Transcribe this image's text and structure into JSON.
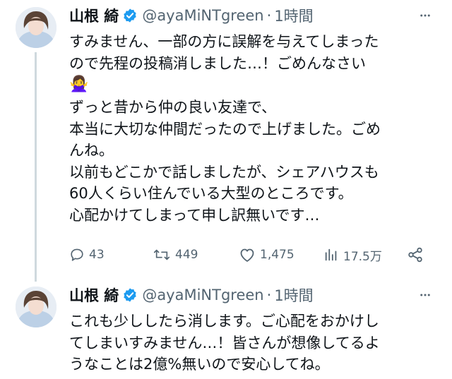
{
  "tweets": [
    {
      "author_name": "山根 綺",
      "handle": "@ayaMiNTgreen",
      "separator": "·",
      "time": "1時間",
      "lines": [
        "すみません、一部の方に誤解を与えてしまった",
        "ので先程の投稿消しました…！ごめんなさい",
        "🙅‍♀️",
        "ずっと昔から仲の良い友達で、",
        "本当に大切な仲間だったので上げました。ごめ",
        "んね。",
        "以前もどこかで話しましたが、シェアハウスも",
        "60人くらい住んでいる大型のところです。",
        "心配かけてしまって申し訳無いです…"
      ],
      "actions": {
        "replies": "43",
        "retweets": "449",
        "likes": "1,475",
        "views": "17.5万"
      }
    },
    {
      "author_name": "山根 綺",
      "handle": "@ayaMiNTgreen",
      "separator": "·",
      "time": "1時間",
      "lines": [
        "これも少ししたら消します。ご心配をおかけし",
        "てしまいすみません…！皆さんが想像してるよ",
        "うなことは2億%無いので安心してね。"
      ]
    }
  ],
  "colors": {
    "verified": "#1d9bf0",
    "secondary_text": "#536471",
    "thread_line": "#cfd9de"
  },
  "icons": [
    "verified-badge-icon",
    "more-icon",
    "reply-icon",
    "retweet-icon",
    "like-icon",
    "views-icon",
    "share-icon"
  ]
}
